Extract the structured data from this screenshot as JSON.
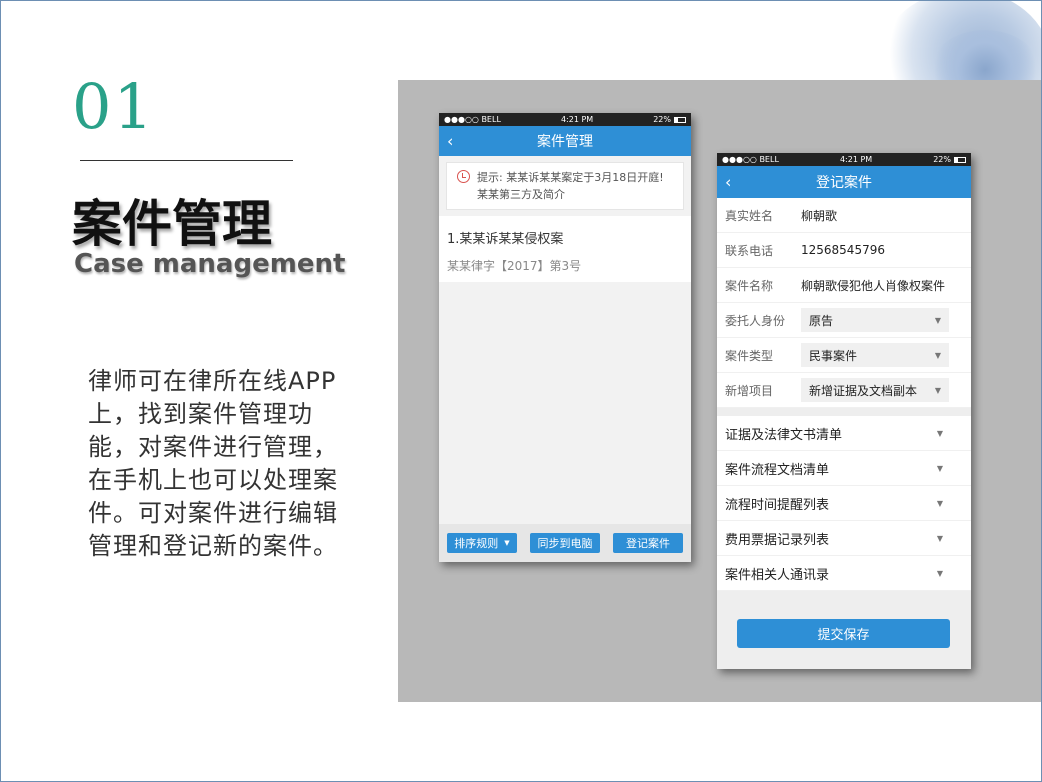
{
  "slide": {
    "number": "01",
    "title_cn": "案件管理",
    "title_en": "Case management",
    "description": "律师可在律所在线APP上，找到案件管理功能，对案件进行管理，在手机上也可以处理案件。可对案件进行编辑管理和登记新的案件。"
  },
  "status_bar": {
    "carrier": "●●●○○ BELL",
    "time": "4:21 PM",
    "battery": "22%"
  },
  "phone_left": {
    "nav_title": "案件管理",
    "back": "‹",
    "alert_line1": "提示: 某某诉某某案定于3月18日开庭!",
    "alert_line2": "某某第三方及简介",
    "case_title": "1.某某诉某某侵权案",
    "case_sub": "某某律字【2017】第3号",
    "btn_sort": "排序规则",
    "btn_sort_caret": "▼",
    "btn_sync": "同步到电脑",
    "btn_register": "登记案件"
  },
  "phone_right": {
    "nav_title": "登记案件",
    "back": "‹",
    "fields": [
      {
        "label": "真实姓名",
        "value": "柳朝歌"
      },
      {
        "label": "联系电话",
        "value": "12568545796"
      },
      {
        "label": "案件名称",
        "value": "柳朝歌侵犯他人肖像权案件"
      }
    ],
    "selects": [
      {
        "label": "委托人身份",
        "value": "原告"
      },
      {
        "label": "案件类型",
        "value": "民事案件"
      },
      {
        "label": "新增项目",
        "value": "新增证据及文档副本"
      }
    ],
    "lists": [
      "证据及法律文书清单",
      "案件流程文档清单",
      "流程时间提醒列表",
      "费用票据记录列表",
      "案件相关人通讯录"
    ],
    "caret": "▼",
    "submit": "提交保存"
  }
}
